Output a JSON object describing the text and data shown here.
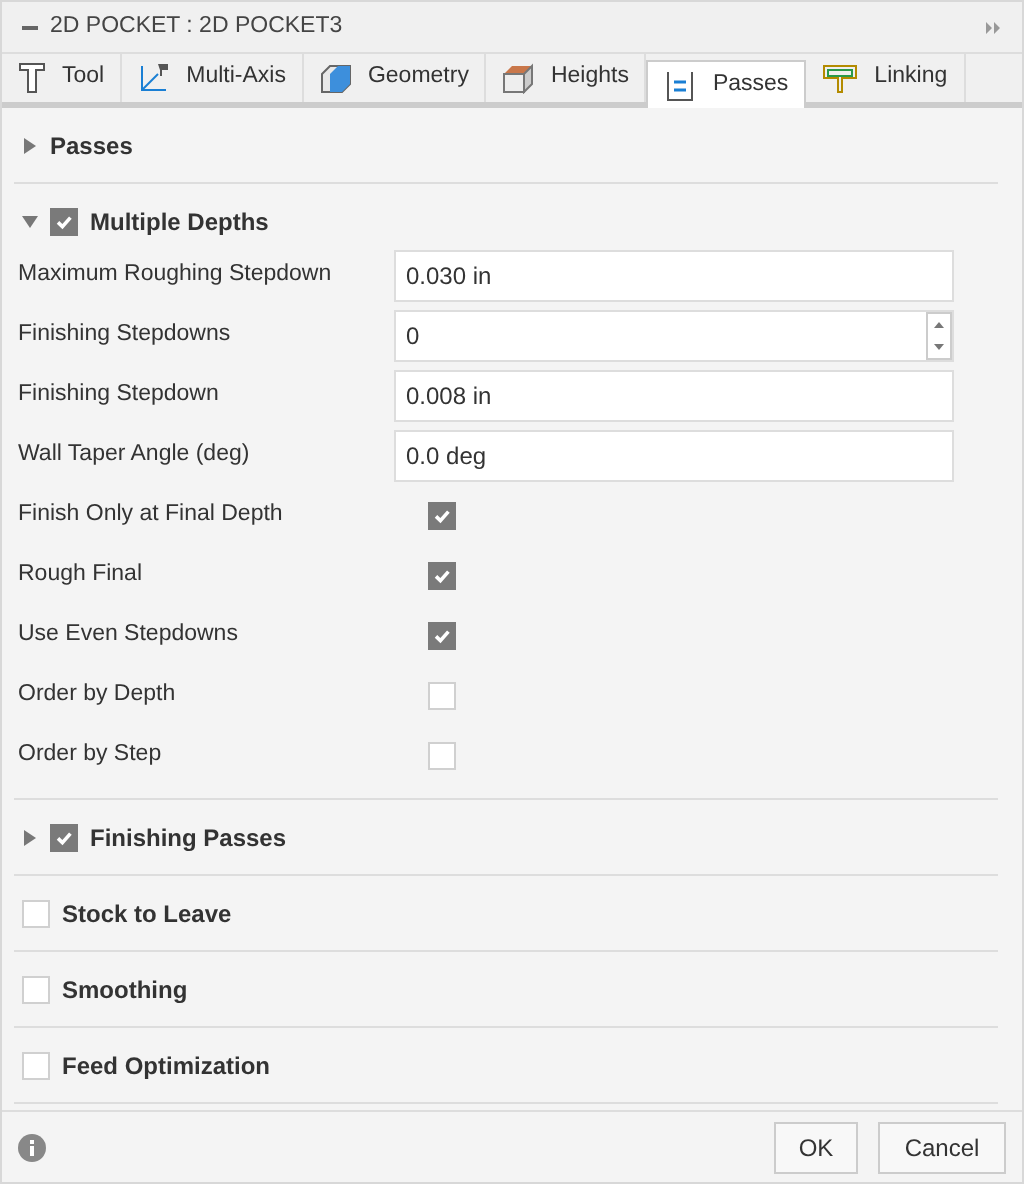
{
  "window": {
    "title": "2D POCKET : 2D POCKET3"
  },
  "tabs": [
    {
      "label": "Tool",
      "selected": false
    },
    {
      "label": "Multi-Axis",
      "selected": false
    },
    {
      "label": "Geometry",
      "selected": false
    },
    {
      "label": "Heights",
      "selected": false
    },
    {
      "label": "Passes",
      "selected": true
    },
    {
      "label": "Linking",
      "selected": false
    }
  ],
  "sections": [
    {
      "title": "Passes",
      "expanded": false
    },
    {
      "title": "Multiple Depths",
      "expanded": true,
      "checked": true,
      "rows": [
        {
          "kind": "text",
          "label": "Maximum Roughing Stepdown",
          "value": "0.030 in"
        },
        {
          "kind": "spinner",
          "label": "Finishing Stepdowns",
          "value": "0"
        },
        {
          "kind": "text",
          "label": "Finishing Stepdown",
          "value": "0.008 in"
        },
        {
          "kind": "text",
          "label": "Wall Taper Angle (deg)",
          "value": "0.0 deg"
        },
        {
          "kind": "checkbox",
          "label": "Finish Only at Final Depth",
          "checked": true
        },
        {
          "kind": "checkbox",
          "label": "Rough Final",
          "checked": true
        },
        {
          "kind": "checkbox",
          "label": "Use Even Stepdowns",
          "checked": true
        },
        {
          "kind": "checkbox",
          "label": "Order by Depth",
          "checked": false
        },
        {
          "kind": "checkbox",
          "label": "Order by Step",
          "checked": false
        }
      ]
    },
    {
      "title": "Finishing Passes",
      "expanded": false,
      "checked": true
    },
    {
      "title": "Stock to Leave",
      "checked": false
    },
    {
      "title": "Smoothing",
      "checked": false
    },
    {
      "title": "Feed Optimization",
      "checked": false
    }
  ],
  "buttons": [
    "OK",
    "Cancel"
  ]
}
